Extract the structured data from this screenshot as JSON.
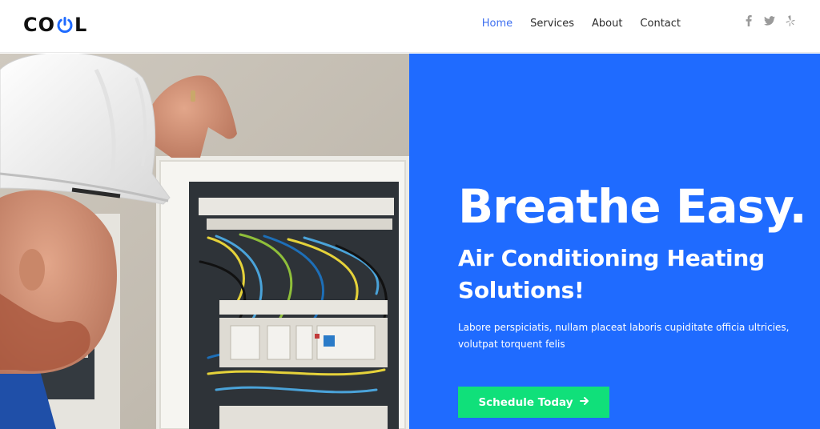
{
  "brand": {
    "logo_left": "CO",
    "logo_right": "L",
    "logo_icon": "power-icon"
  },
  "nav": {
    "items": [
      {
        "label": "Home",
        "active": true
      },
      {
        "label": "Services",
        "active": false
      },
      {
        "label": "About",
        "active": false
      },
      {
        "label": "Contact",
        "active": false
      }
    ],
    "active_color": "#3e6ff0"
  },
  "social": {
    "icons": [
      "facebook-icon",
      "twitter-icon",
      "yelp-icon"
    ]
  },
  "hero": {
    "headline": "Breathe Easy.",
    "subheadline": "Air Conditioning Heating Solutions!",
    "body": "Labore perspiciatis, nullam placeat laboris cupiditate officia ultricies, volutpat torquent felis",
    "cta_label": "Schedule Today",
    "cta_icon": "arrow-right-icon",
    "panel_color": "#1f6bff",
    "cta_color": "#10e07a"
  }
}
